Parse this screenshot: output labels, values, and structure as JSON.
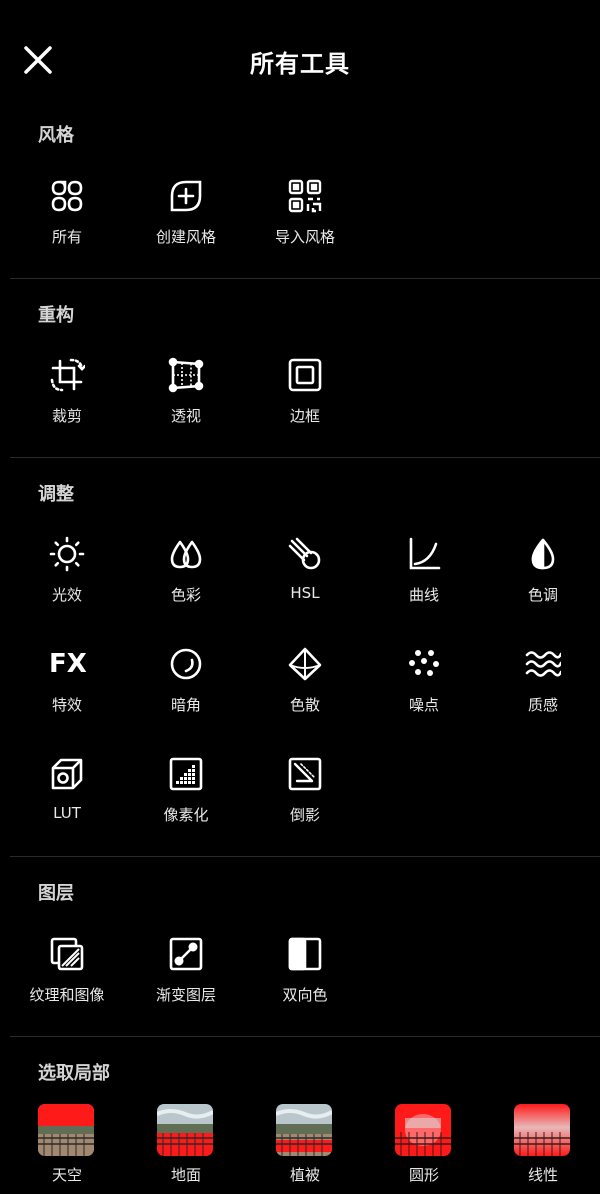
{
  "header": {
    "title": "所有工具"
  },
  "sections": {
    "style": {
      "title": "风格",
      "tools": [
        {
          "label": "所有",
          "icon": "four-petal-grid-icon"
        },
        {
          "label": "创建风格",
          "icon": "add-leaf-icon"
        },
        {
          "label": "导入风格",
          "icon": "qr-code-icon"
        }
      ]
    },
    "restructure": {
      "title": "重构",
      "tools": [
        {
          "label": "裁剪",
          "icon": "crop-rotate-icon"
        },
        {
          "label": "透视",
          "icon": "perspective-grid-icon"
        },
        {
          "label": "边框",
          "icon": "border-frame-icon"
        }
      ]
    },
    "adjust": {
      "title": "调整",
      "tools": [
        {
          "label": "光效",
          "icon": "sun-icon"
        },
        {
          "label": "色彩",
          "icon": "color-drops-icon"
        },
        {
          "label": "HSL",
          "icon": "hsl-icon"
        },
        {
          "label": "曲线",
          "icon": "curve-icon"
        },
        {
          "label": "色调",
          "icon": "tone-drop-icon"
        },
        {
          "label": "特效",
          "icon": "fx-icon",
          "icon_text": "FX"
        },
        {
          "label": "暗角",
          "icon": "vignette-icon"
        },
        {
          "label": "色散",
          "icon": "prism-icon"
        },
        {
          "label": "噪点",
          "icon": "noise-dots-icon"
        },
        {
          "label": "质感",
          "icon": "texture-waves-icon"
        },
        {
          "label": "LUT",
          "icon": "lut-cube-icon"
        },
        {
          "label": "像素化",
          "icon": "pixelate-icon"
        },
        {
          "label": "倒影",
          "icon": "reflection-icon"
        }
      ]
    },
    "layers": {
      "title": "图层",
      "tools": [
        {
          "label": "纹理和图像",
          "icon": "texture-image-icon"
        },
        {
          "label": "渐变图层",
          "icon": "gradient-layer-icon"
        },
        {
          "label": "双向色",
          "icon": "duotone-icon"
        }
      ]
    },
    "masks": {
      "title": "选取局部",
      "tools": [
        {
          "label": "天空",
          "icon": "sky-mask-thumbnail"
        },
        {
          "label": "地面",
          "icon": "ground-mask-thumbnail"
        },
        {
          "label": "植被",
          "icon": "vegetation-mask-thumbnail"
        },
        {
          "label": "圆形",
          "icon": "circle-mask-thumbnail"
        },
        {
          "label": "线性",
          "icon": "linear-mask-thumbnail"
        }
      ]
    }
  },
  "colors": {
    "background": "#000000",
    "text": "#ffffff",
    "mask_highlight": "#ff1a1a"
  }
}
